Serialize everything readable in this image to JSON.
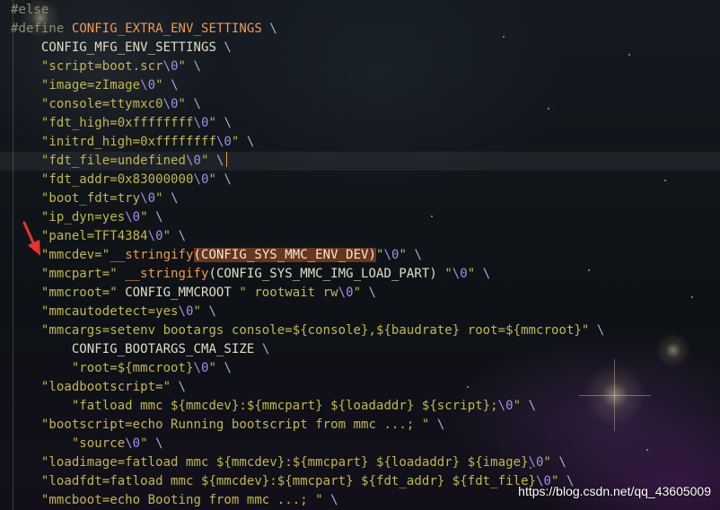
{
  "editor": {
    "lines": [
      [
        {
          "t": "#else",
          "c": "pre"
        }
      ],
      [
        {
          "t": "#define ",
          "c": "pre"
        },
        {
          "t": "CONFIG_EXTRA_ENV_SETTINGS",
          "c": "def"
        },
        {
          "t": " \\",
          "c": "op"
        }
      ],
      [
        {
          "t": "    CONFIG_MFG_ENV_SETTINGS ",
          "c": "macro"
        },
        {
          "t": "\\",
          "c": "op"
        }
      ],
      [
        {
          "t": "    \"script=boot.scr",
          "c": "str"
        },
        {
          "t": "\\0",
          "c": "esc"
        },
        {
          "t": "\" ",
          "c": "str"
        },
        {
          "t": "\\",
          "c": "op"
        }
      ],
      [
        {
          "t": "    \"image=zImage",
          "c": "str"
        },
        {
          "t": "\\0",
          "c": "esc"
        },
        {
          "t": "\" ",
          "c": "str"
        },
        {
          "t": "\\",
          "c": "op"
        }
      ],
      [
        {
          "t": "    \"console=ttymxc0",
          "c": "str"
        },
        {
          "t": "\\0",
          "c": "esc"
        },
        {
          "t": "\" ",
          "c": "str"
        },
        {
          "t": "\\",
          "c": "op"
        }
      ],
      [
        {
          "t": "    \"fdt_high=0xffffffff",
          "c": "str"
        },
        {
          "t": "\\0",
          "c": "esc"
        },
        {
          "t": "\" ",
          "c": "str"
        },
        {
          "t": "\\",
          "c": "op"
        }
      ],
      [
        {
          "t": "    \"initrd_high=0xffffffff",
          "c": "str"
        },
        {
          "t": "\\0",
          "c": "esc"
        },
        {
          "t": "\" ",
          "c": "str"
        },
        {
          "t": "\\",
          "c": "op"
        }
      ],
      [
        {
          "t": "    \"fdt_file=undefined",
          "c": "str"
        },
        {
          "t": "\\0",
          "c": "esc"
        },
        {
          "t": "\" ",
          "c": "str"
        },
        {
          "t": "\\",
          "c": "op"
        }
      ],
      [
        {
          "t": "    \"fdt_addr=0x83000000",
          "c": "str"
        },
        {
          "t": "\\0",
          "c": "esc"
        },
        {
          "t": "\" ",
          "c": "str"
        },
        {
          "t": "\\",
          "c": "op"
        }
      ],
      [
        {
          "t": "    \"boot_fdt=try",
          "c": "str"
        },
        {
          "t": "\\0",
          "c": "esc"
        },
        {
          "t": "\" ",
          "c": "str"
        },
        {
          "t": "\\",
          "c": "op"
        }
      ],
      [
        {
          "t": "    \"ip_dyn=yes",
          "c": "str"
        },
        {
          "t": "\\0",
          "c": "esc"
        },
        {
          "t": "\" ",
          "c": "str"
        },
        {
          "t": "\\",
          "c": "op"
        }
      ],
      [
        {
          "t": "    \"panel=TFT4384",
          "c": "str"
        },
        {
          "t": "\\0",
          "c": "esc"
        },
        {
          "t": "\" ",
          "c": "str"
        },
        {
          "t": "\\",
          "c": "op"
        }
      ],
      [
        {
          "t": "    \"mmcdev=\"",
          "c": "str"
        },
        {
          "t": "__stringify",
          "c": "call"
        },
        {
          "t": "(CONFIG_SYS_MMC_ENV_DEV)",
          "c": "hl"
        },
        {
          "t": "\"",
          "c": "str"
        },
        {
          "t": "\\0",
          "c": "esc"
        },
        {
          "t": "\" ",
          "c": "str"
        },
        {
          "t": "\\",
          "c": "op"
        }
      ],
      [
        {
          "t": "    \"mmcpart=\" ",
          "c": "str"
        },
        {
          "t": "__stringify",
          "c": "call"
        },
        {
          "t": "(CONFIG_SYS_MMC_IMG_LOAD_PART) ",
          "c": "macro"
        },
        {
          "t": "\"",
          "c": "str"
        },
        {
          "t": "\\0",
          "c": "esc"
        },
        {
          "t": "\" ",
          "c": "str"
        },
        {
          "t": "\\",
          "c": "op"
        }
      ],
      [
        {
          "t": "    \"mmcroot=\" ",
          "c": "str"
        },
        {
          "t": "CONFIG_MMCROOT ",
          "c": "macro"
        },
        {
          "t": "\" rootwait rw",
          "c": "str"
        },
        {
          "t": "\\0",
          "c": "esc"
        },
        {
          "t": "\" ",
          "c": "str"
        },
        {
          "t": "\\",
          "c": "op"
        }
      ],
      [
        {
          "t": "    \"mmcautodetect=yes",
          "c": "str"
        },
        {
          "t": "\\0",
          "c": "esc"
        },
        {
          "t": "\" ",
          "c": "str"
        },
        {
          "t": "\\",
          "c": "op"
        }
      ],
      [
        {
          "t": "    \"mmcargs=setenv bootargs console=${console},${baudrate} root=${mmcroot}\" ",
          "c": "str"
        },
        {
          "t": "\\",
          "c": "op"
        }
      ],
      [
        {
          "t": "        CONFIG_BOOTARGS_CMA_SIZE ",
          "c": "macro"
        },
        {
          "t": "\\",
          "c": "op"
        }
      ],
      [
        {
          "t": "        \"root=${mmcroot}",
          "c": "str"
        },
        {
          "t": "\\0",
          "c": "esc"
        },
        {
          "t": "\" ",
          "c": "str"
        },
        {
          "t": "\\",
          "c": "op"
        }
      ],
      [
        {
          "t": "    \"loadbootscript=\" ",
          "c": "str"
        },
        {
          "t": "\\",
          "c": "op"
        }
      ],
      [
        {
          "t": "        \"fatload mmc ${mmcdev}:${mmcpart} ${loadaddr} ${script};",
          "c": "str"
        },
        {
          "t": "\\0",
          "c": "esc"
        },
        {
          "t": "\" ",
          "c": "str"
        },
        {
          "t": "\\",
          "c": "op"
        }
      ],
      [
        {
          "t": "    \"bootscript=echo Running bootscript from mmc ...; \" ",
          "c": "str"
        },
        {
          "t": "\\",
          "c": "op"
        }
      ],
      [
        {
          "t": "        \"source",
          "c": "str"
        },
        {
          "t": "\\0",
          "c": "esc"
        },
        {
          "t": "\" ",
          "c": "str"
        },
        {
          "t": "\\",
          "c": "op"
        }
      ],
      [
        {
          "t": "    \"loadimage=fatload mmc ${mmcdev}:${mmcpart} ${loadaddr} ${image}",
          "c": "str"
        },
        {
          "t": "\\0",
          "c": "esc"
        },
        {
          "t": "\" ",
          "c": "str"
        },
        {
          "t": "\\",
          "c": "op"
        }
      ],
      [
        {
          "t": "    \"loadfdt=fatload mmc ${mmcdev}:${mmcpart} ${fdt_addr} ${fdt_file}",
          "c": "str"
        },
        {
          "t": "\\0",
          "c": "esc"
        },
        {
          "t": "\" ",
          "c": "str"
        },
        {
          "t": "\\",
          "c": "op"
        }
      ],
      [
        {
          "t": "    \"mmcboot=echo Booting from mmc ...; \" ",
          "c": "str"
        },
        {
          "t": "\\",
          "c": "op"
        }
      ]
    ]
  },
  "watermark": {
    "text": "https://blog.csdn.net/qq_43605009"
  },
  "icons": {
    "annotation_arrow": "red-arrow-icon",
    "arrow_color": "#e8322b"
  },
  "colors": {
    "preprocessor": "#8a8f6f",
    "macro": "#e0dcc6",
    "string": "#c2b84a",
    "escape": "#a58ee6",
    "operator": "#9fb4d6",
    "define_name": "#ec9b53",
    "function_call": "#ef9a46"
  }
}
